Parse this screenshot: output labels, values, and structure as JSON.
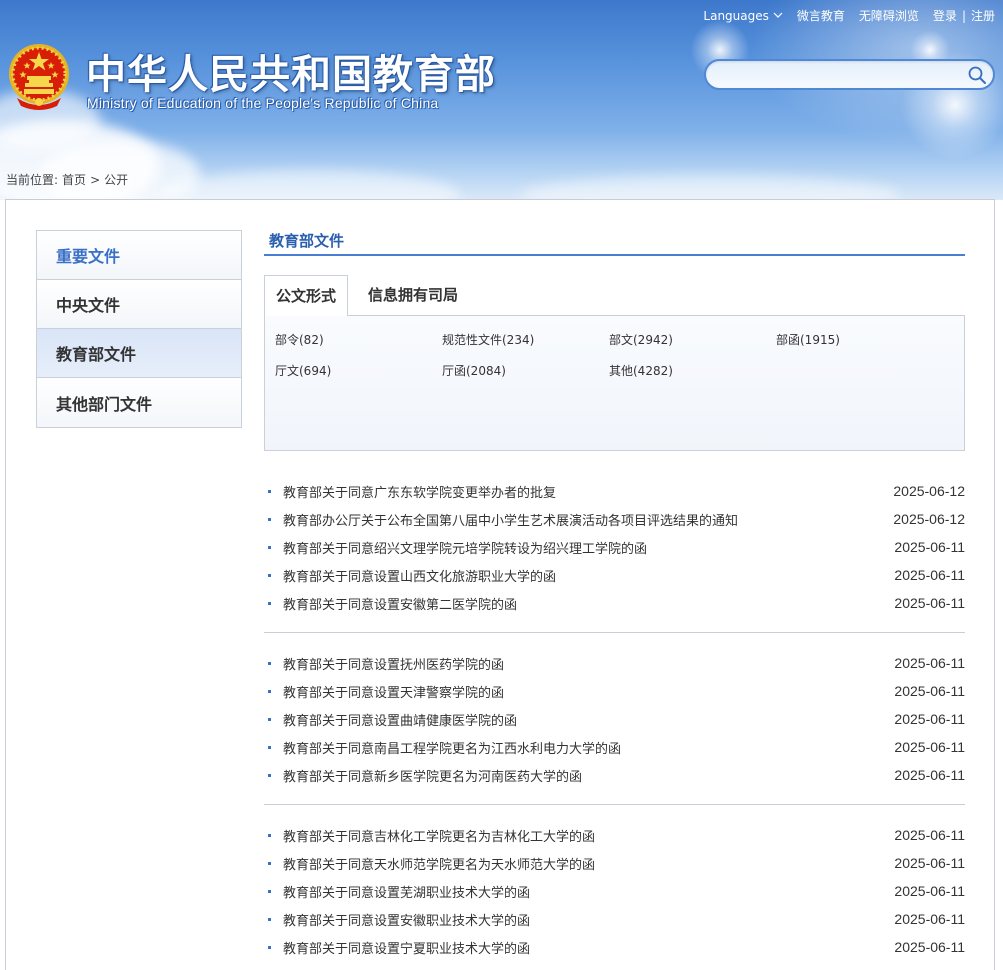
{
  "header": {
    "title_cn": "中华人民共和国教育部",
    "title_en": "Ministry of Education of the People's Republic of China",
    "topnav": {
      "languages": "Languages",
      "weiyan": "微言教育",
      "accessible": "无障碍浏览",
      "login": "登录",
      "separator": "|",
      "register": "注册"
    },
    "search": {
      "placeholder": "",
      "value": ""
    }
  },
  "breadcrumb": {
    "prefix": "当前位置:",
    "home": "首页",
    "separator": ">",
    "current": "公开"
  },
  "sidebar": {
    "items": [
      {
        "label": "重要文件"
      },
      {
        "label": "中央文件"
      },
      {
        "label": "教育部文件"
      },
      {
        "label": "其他部门文件"
      }
    ]
  },
  "content": {
    "section_title": "教育部文件",
    "tabs": [
      {
        "label": "公文形式"
      },
      {
        "label": "信息拥有司局"
      }
    ],
    "filters": [
      {
        "label": "部令(82)"
      },
      {
        "label": "规范性文件(234)"
      },
      {
        "label": "部文(2942)"
      },
      {
        "label": "部函(1915)"
      },
      {
        "label": "厅文(694)"
      },
      {
        "label": "厅函(2084)"
      },
      {
        "label": "其他(4282)"
      }
    ],
    "groups": [
      [
        {
          "title": "教育部关于同意广东东软学院变更举办者的批复",
          "date": "2025-06-12"
        },
        {
          "title": "教育部办公厅关于公布全国第八届中小学生艺术展演活动各项目评选结果的通知",
          "date": "2025-06-12"
        },
        {
          "title": "教育部关于同意绍兴文理学院元培学院转设为绍兴理工学院的函",
          "date": "2025-06-11"
        },
        {
          "title": "教育部关于同意设置山西文化旅游职业大学的函",
          "date": "2025-06-11"
        },
        {
          "title": "教育部关于同意设置安徽第二医学院的函",
          "date": "2025-06-11"
        }
      ],
      [
        {
          "title": "教育部关于同意设置抚州医药学院的函",
          "date": "2025-06-11"
        },
        {
          "title": "教育部关于同意设置天津警察学院的函",
          "date": "2025-06-11"
        },
        {
          "title": "教育部关于同意设置曲靖健康医学院的函",
          "date": "2025-06-11"
        },
        {
          "title": "教育部关于同意南昌工程学院更名为江西水利电力大学的函",
          "date": "2025-06-11"
        },
        {
          "title": "教育部关于同意新乡医学院更名为河南医药大学的函",
          "date": "2025-06-11"
        }
      ],
      [
        {
          "title": "教育部关于同意吉林化工学院更名为吉林化工大学的函",
          "date": "2025-06-11"
        },
        {
          "title": "教育部关于同意天水师范学院更名为天水师范大学的函",
          "date": "2025-06-11"
        },
        {
          "title": "教育部关于同意设置芜湖职业技术大学的函",
          "date": "2025-06-11"
        },
        {
          "title": "教育部关于同意设置安徽职业技术大学的函",
          "date": "2025-06-11"
        },
        {
          "title": "教育部关于同意设置宁夏职业技术大学的函",
          "date": "2025-06-11"
        }
      ]
    ]
  },
  "colors": {
    "accent": "#3a70c8",
    "title_underline": "#4a7ed3",
    "header_blue": "#3d78cc"
  },
  "icons": {
    "emblem": "national-emblem-icon",
    "search": "search-icon",
    "dropdown": "chevron-down-icon"
  }
}
